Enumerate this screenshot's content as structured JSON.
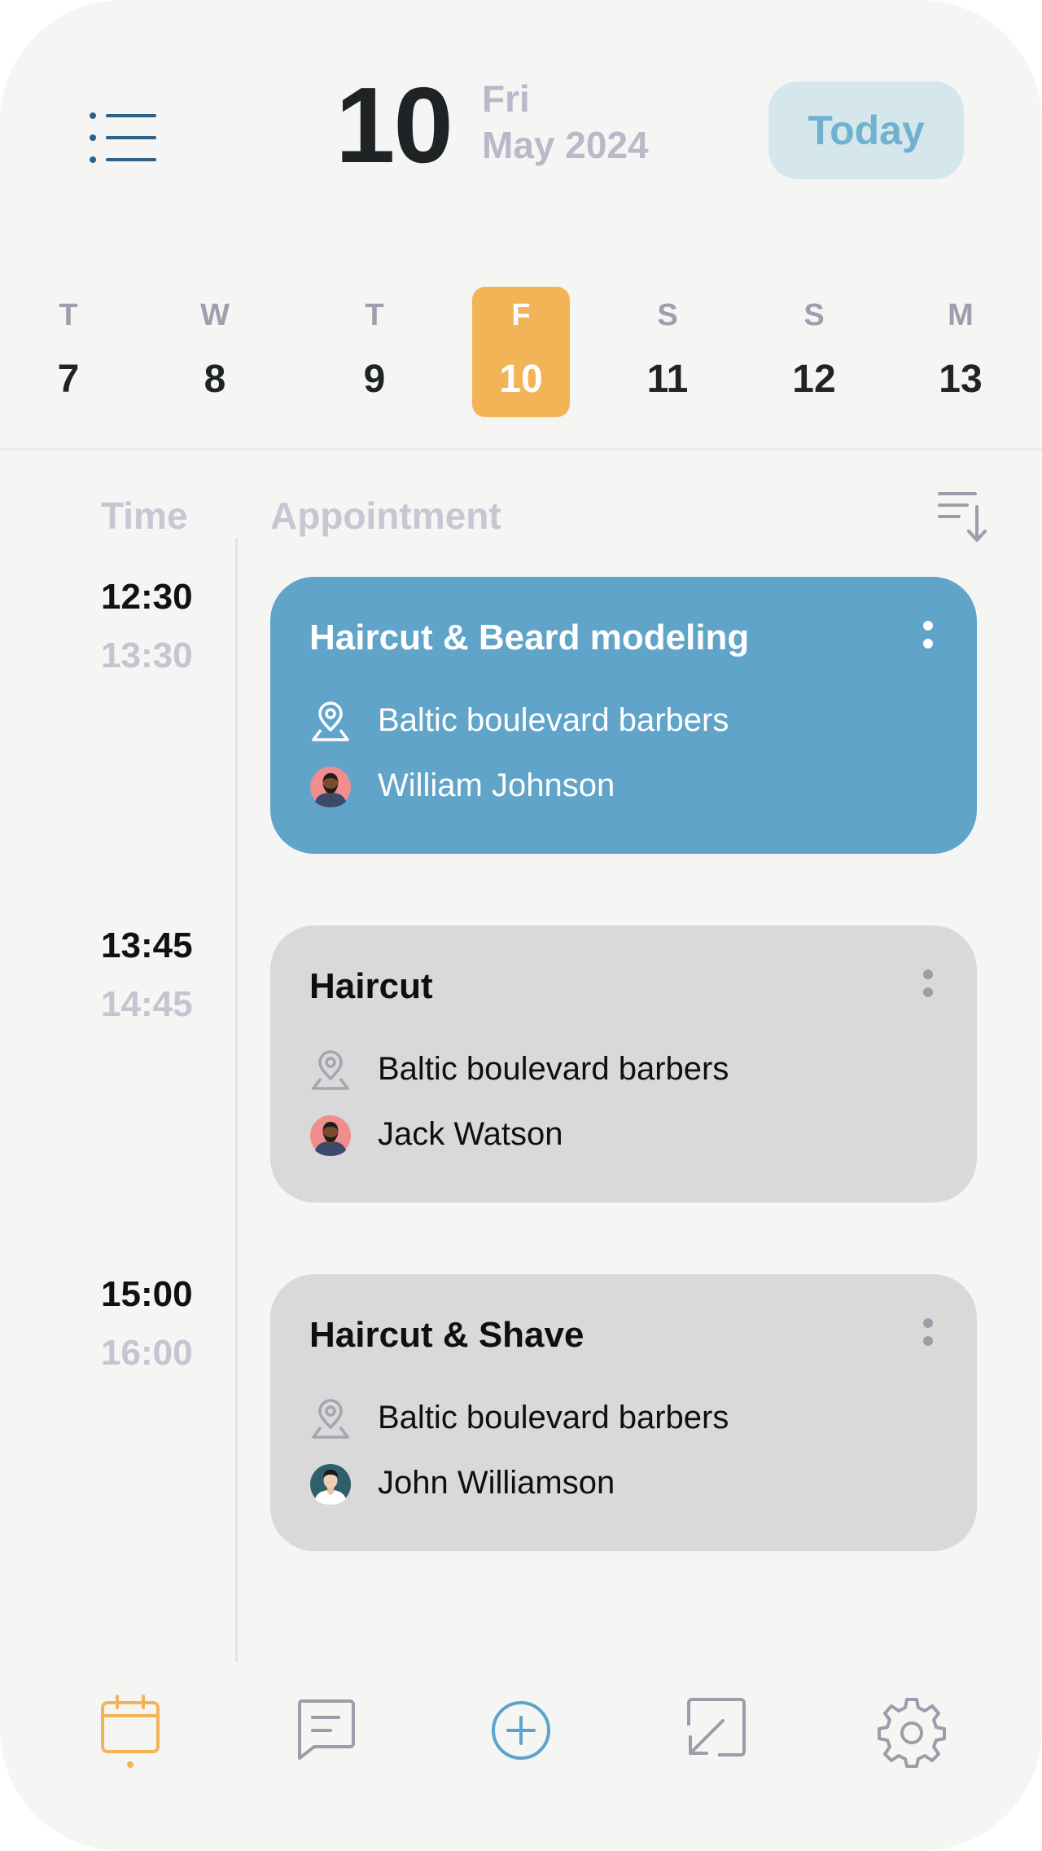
{
  "header": {
    "day_number": "10",
    "day_of_week": "Fri",
    "month_year": "May 2024",
    "today_label": "Today"
  },
  "week": [
    {
      "letter": "T",
      "number": "7",
      "selected": false
    },
    {
      "letter": "W",
      "number": "8",
      "selected": false
    },
    {
      "letter": "T",
      "number": "9",
      "selected": false
    },
    {
      "letter": "F",
      "number": "10",
      "selected": true
    },
    {
      "letter": "S",
      "number": "11",
      "selected": false
    },
    {
      "letter": "S",
      "number": "12",
      "selected": false
    },
    {
      "letter": "M",
      "number": "13",
      "selected": false
    }
  ],
  "columns": {
    "time": "Time",
    "appointment": "Appointment"
  },
  "appointments": [
    {
      "start": "12:30",
      "end": "13:30",
      "title": "Haircut & Beard modeling",
      "location": "Baltic boulevard barbers",
      "client": "William Johnson",
      "active": true
    },
    {
      "start": "13:45",
      "end": "14:45",
      "title": "Haircut",
      "location": "Baltic boulevard barbers",
      "client": "Jack Watson",
      "active": false
    },
    {
      "start": "15:00",
      "end": "16:00",
      "title": "Haircut & Shave",
      "location": "Baltic boulevard barbers",
      "client": "John Williamson",
      "active": false
    }
  ],
  "icons": {
    "menu": "list-menu-icon",
    "sort": "sort-descending-icon",
    "location": "map-pin-icon",
    "more": "kebab-menu-icon",
    "nav": [
      "calendar-icon",
      "message-icon",
      "add-circle-icon",
      "resize-arrow-icon",
      "gear-icon"
    ]
  },
  "colors": {
    "background": "#f5f5f4",
    "accent_orange": "#f3b457",
    "active_card": "#60a4c9",
    "idle_card": "#d9d9d9",
    "today_button_bg": "#d5e6ec",
    "today_button_text": "#6fb1cf",
    "menu_icon": "#2c6189"
  }
}
